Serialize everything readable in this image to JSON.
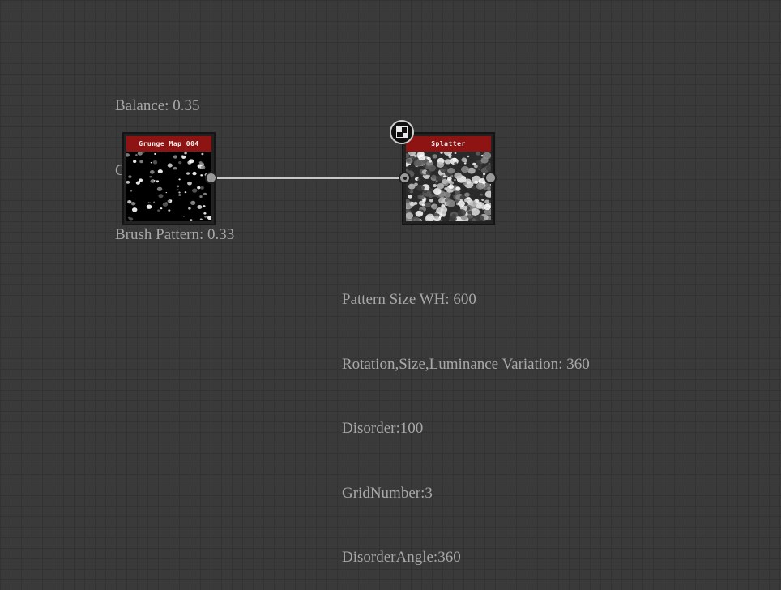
{
  "left_params": [
    "Balance: 0.35",
    "Contrast: 0.3",
    "Brush Pattern: 0.33"
  ],
  "right_params": [
    "Pattern Size WH: 600",
    "Rotation,Size,Luminance Variation: 360",
    "Disorder:100",
    "GridNumber:3",
    "DisorderAngle:360"
  ],
  "nodes": {
    "grunge": {
      "title": "Grunge Map 004"
    },
    "splatter": {
      "title": "Splatter"
    }
  },
  "colors": {
    "canvas": "#3a3a3a",
    "node_header": "#8e1414",
    "wire": "#c8c8c8",
    "param_text": "#a8a8a8"
  },
  "icons": {
    "badge": "checker-pattern-icon"
  }
}
